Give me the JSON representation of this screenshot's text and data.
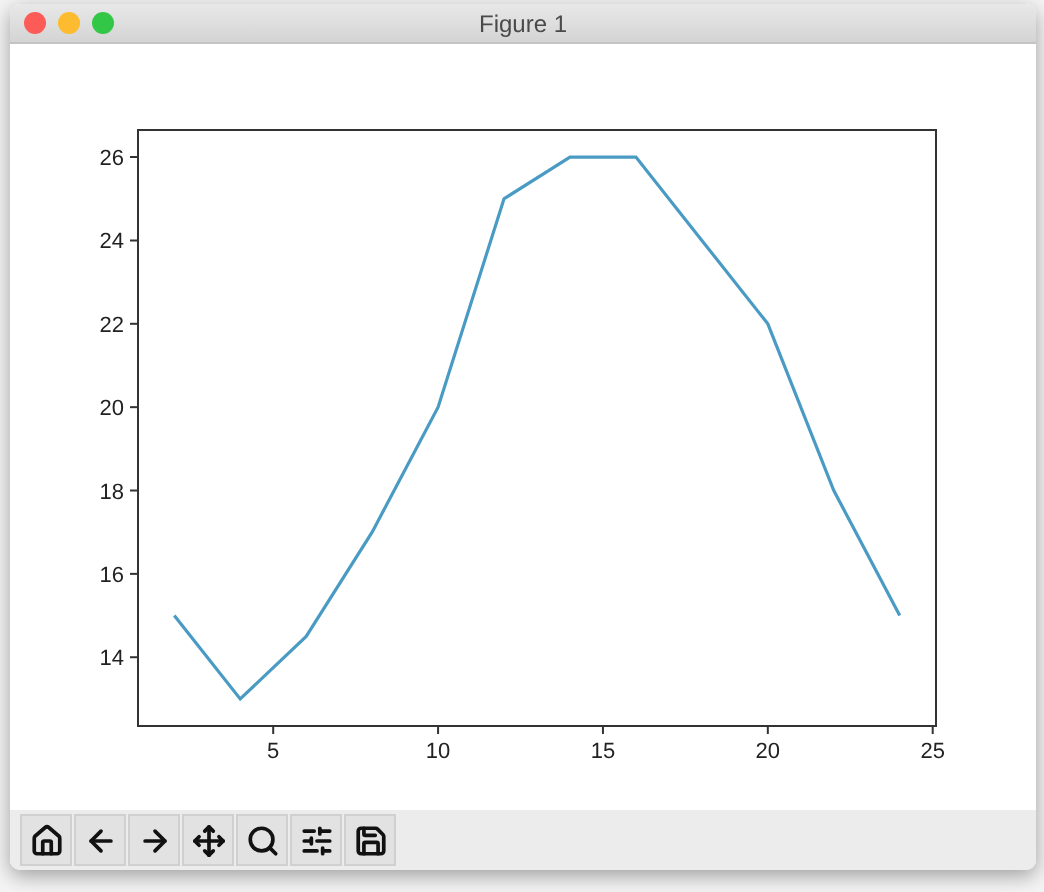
{
  "window": {
    "title": "Figure 1"
  },
  "figure": {
    "chart_data": {
      "type": "line",
      "x": [
        2,
        4,
        6,
        8,
        10,
        12,
        14,
        16,
        18,
        20,
        22,
        24
      ],
      "series": [
        {
          "color": "#4a9bc4",
          "values": [
            15,
            13,
            14.5,
            17,
            20,
            25,
            26,
            26,
            24,
            22,
            18,
            15
          ]
        }
      ],
      "xlim": [
        0.9,
        25.1
      ],
      "ylim": [
        12.35,
        26.65
      ],
      "xticks": [
        5,
        10,
        15,
        20,
        25
      ],
      "yticks": [
        14,
        16,
        18,
        20,
        22,
        24,
        26
      ]
    }
  }
}
